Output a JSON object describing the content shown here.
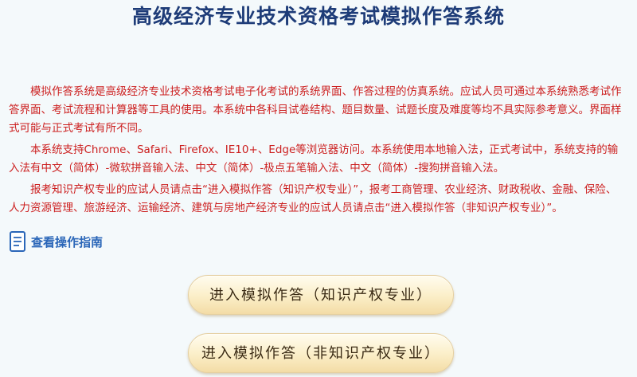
{
  "page": {
    "title": "高级经济专业技术资格考试模拟作答系统"
  },
  "notice": {
    "paragraphs": [
      "模拟作答系统是高级经济专业技术资格考试电子化考试的系统界面、作答过程的仿真系统。应试人员可通过本系统熟悉考试作答界面、考试流程和计算器等工具的使用。本系统中各科目试卷结构、题目数量、试题长度及难度等均不具实际参考意义。界面样式可能与正式考试有所不同。",
      "本系统支持Chrome、Safari、Firefox、IE10+、Edge等浏览器访问。本系统使用本地输入法，正式考试中，系统支持的输入法有中文（简体）-微软拼音输入法、中文（简体）-极点五笔输入法、中文（简体）-搜狗拼音输入法。",
      "报考知识产权专业的应试人员请点击“进入模拟作答（知识产权专业）”，报考工商管理、农业经济、财政税收、金融、保险、人力资源管理、旅游经济、运输经济、建筑与房地产经济专业的应试人员请点击“进入模拟作答（非知识产权专业）”。"
    ]
  },
  "guide": {
    "label": "查看操作指南",
    "icon": "document-icon"
  },
  "buttons": {
    "ip_major": "进入模拟作答（知识产权专业）",
    "non_ip_major": "进入模拟作答（非知识产权专业）"
  },
  "colors": {
    "title": "#1e3c78",
    "notice_text": "#cc1f1f",
    "guide_link": "#2a66b8",
    "button_fill": "#fbeec7",
    "background": "#f4f9fb"
  }
}
